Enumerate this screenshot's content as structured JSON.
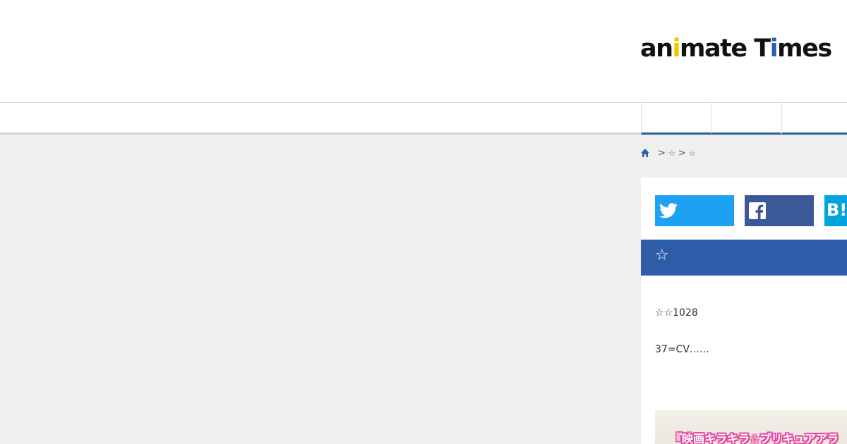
{
  "header": {
    "logo": {
      "part1": "an",
      "i1": "i",
      "part2": "mate T",
      "i2": "i",
      "part3": "mes"
    }
  },
  "nav": {
    "tabs": [
      "",
      "",
      ""
    ]
  },
  "breadcrumb": {
    "home_icon": "home-icon",
    "separator": ">",
    "items": [
      "☆",
      "☆"
    ]
  },
  "share": {
    "twitter_icon": "twitter-icon",
    "facebook_icon": "facebook-icon",
    "hatena_label": "B!"
  },
  "article": {
    "title": "☆",
    "paragraphs": [
      "☆☆1028",
      "37=CV……"
    ],
    "thumbnail_caption": "『映画キラキラ☆プリキュアアラ"
  },
  "colors": {
    "brand_blue": "#2e5ca8",
    "twitter": "#1da1f2",
    "facebook": "#3b5998",
    "hatena": "#00a4de",
    "logo_accent": "#f4c400"
  }
}
